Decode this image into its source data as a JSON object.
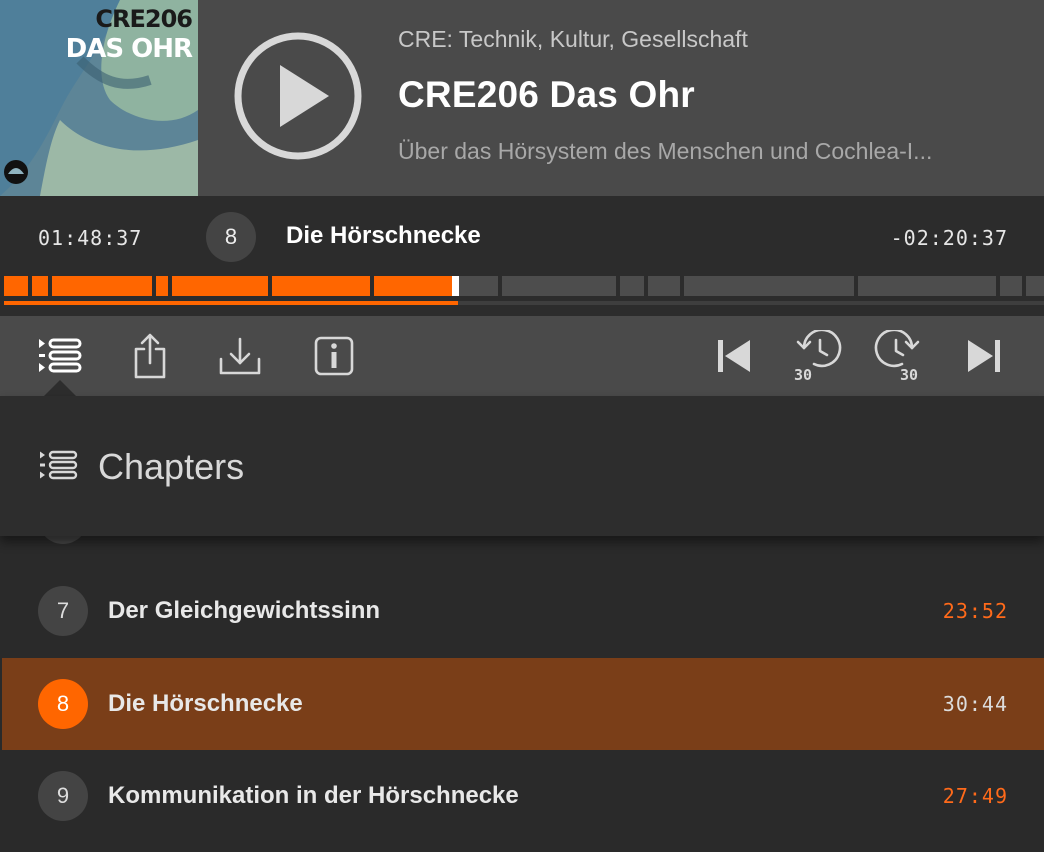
{
  "cover": {
    "line1": "CRE206",
    "line2": "DAS OHR"
  },
  "header": {
    "show": "CRE: Technik, Kultur, Gesellschaft",
    "title": "CRE206 Das Ohr",
    "subtitle": "Über das Hörsystem des Menschen und Cochlea-I..."
  },
  "progress": {
    "elapsed": "01:48:37",
    "remaining": "-02:20:37",
    "chapter_number": "8",
    "chapter_title": "Die Hörschnecke",
    "overall_fraction": 0.437
  },
  "toolbar": {
    "buttons": [
      "chapters",
      "share",
      "download",
      "info",
      "previous-chapter",
      "rewind-30",
      "forward-30",
      "next-chapter"
    ],
    "skip_seconds": "30"
  },
  "chapters": {
    "heading": "Chapters",
    "items": [
      {
        "number": "7",
        "title": "Der Gleichgewichtssinn",
        "duration": "23:52",
        "active": false
      },
      {
        "number": "8",
        "title": "Die Hörschnecke",
        "duration": "30:44",
        "active": true
      },
      {
        "number": "9",
        "title": "Kommunikation in der Hörschnecke",
        "duration": "27:49",
        "active": false
      }
    ]
  },
  "colors": {
    "accent": "#ff6600",
    "active_row": "#7a3e18",
    "header_bg": "#4a4a4a",
    "panel_bg": "#2a2a2a"
  }
}
